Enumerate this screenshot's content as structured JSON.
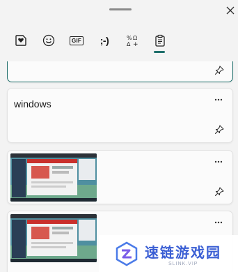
{
  "panel": {
    "tabs": [
      {
        "name": "sticker"
      },
      {
        "name": "emoji"
      },
      {
        "name": "gif",
        "label": "GIF"
      },
      {
        "name": "kaomoji",
        "label": ";-)"
      },
      {
        "name": "symbols"
      },
      {
        "name": "clipboard",
        "selected": true
      }
    ]
  },
  "clipboard": {
    "items": [
      {
        "type": "text",
        "text": ""
      },
      {
        "type": "text",
        "text": "windows"
      },
      {
        "type": "image"
      },
      {
        "type": "image"
      }
    ]
  },
  "watermark": {
    "title": "速链游戏园",
    "subtitle": "SLINK.VIP"
  },
  "colors": {
    "accent": "#1f6f6b",
    "background": "#f3f3f3",
    "card": "#fbfbfb",
    "watermark_blue": "#3b5fd4"
  }
}
